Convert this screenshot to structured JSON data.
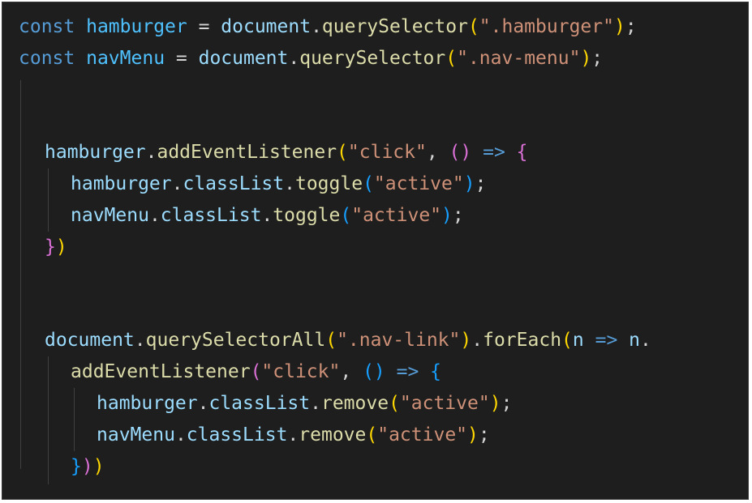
{
  "colors": {
    "background": "#1e1e1e",
    "keyword": "#569cd6",
    "constant": "#4fc1ff",
    "variable": "#9cdcfe",
    "function": "#dcdcaa",
    "string": "#ce9178",
    "bracket_level1": "#ffd700",
    "bracket_level2": "#da70d6",
    "bracket_level3": "#179fff"
  },
  "code": {
    "line1": {
      "kw": "const",
      "name": "hamburger",
      "eq": " = ",
      "obj": "document",
      "dot": ".",
      "method": "querySelector",
      "open": "(",
      "arg": "\".hamburger\"",
      "close": ")",
      "end": ";"
    },
    "line2": {
      "kw": "const",
      "name": "navMenu",
      "eq": " = ",
      "obj": "document",
      "dot": ".",
      "method": "querySelector",
      "open": "(",
      "arg": "\".nav-menu\"",
      "close": ")",
      "end": ";"
    },
    "line5": {
      "obj": "hamburger",
      "dot": ".",
      "method": "addEventListener",
      "open": "(",
      "arg": "\"click\"",
      "comma": ", ",
      "arrow_open": "(",
      "arrow_close": ")",
      "arrow": " => ",
      "brace": "{"
    },
    "line6": {
      "obj": "hamburger",
      "dot1": ".",
      "prop": "classList",
      "dot2": ".",
      "method": "toggle",
      "open": "(",
      "arg": "\"active\"",
      "close": ")",
      "end": ";"
    },
    "line7": {
      "obj": "navMenu",
      "dot1": ".",
      "prop": "classList",
      "dot2": ".",
      "method": "toggle",
      "open": "(",
      "arg": "\"active\"",
      "close": ")",
      "end": ";"
    },
    "line8": {
      "brace": "}",
      "paren": ")"
    },
    "line11": {
      "obj": "document",
      "dot1": ".",
      "method": "querySelectorAll",
      "open": "(",
      "arg": "\".nav-link\"",
      "close": ")",
      "dot2": ".",
      "method2": "forEach",
      "open2": "(",
      "param": "n",
      "arrow": " => ",
      "obj2": "n",
      "dot3": "."
    },
    "line12": {
      "method": "addEventListener",
      "open": "(",
      "arg": "\"click\"",
      "comma": ", ",
      "arrow_open": "(",
      "arrow_close": ")",
      "arrow": " => ",
      "brace": "{"
    },
    "line13": {
      "obj": "hamburger",
      "dot1": ".",
      "prop": "classList",
      "dot2": ".",
      "method": "remove",
      "open": "(",
      "arg": "\"active\"",
      "close": ")",
      "end": ";"
    },
    "line14": {
      "obj": "navMenu",
      "dot1": ".",
      "prop": "classList",
      "dot2": ".",
      "method": "remove",
      "open": "(",
      "arg": "\"active\"",
      "close": ")",
      "end": ";"
    },
    "line15": {
      "brace": "}",
      "paren1": ")",
      "paren2": ")"
    }
  }
}
